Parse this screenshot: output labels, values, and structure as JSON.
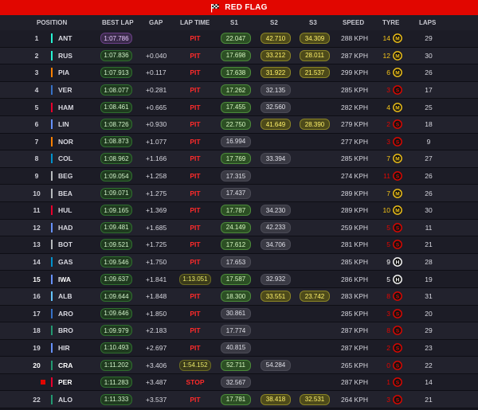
{
  "banner": {
    "label": "RED FLAG",
    "icon": "checkered-flag-icon"
  },
  "columns": {
    "position": "POSITION",
    "best_lap": "BEST LAP",
    "gap": "GAP",
    "lap_time": "LAP TIME",
    "s1": "S1",
    "s2": "S2",
    "s3": "S3",
    "speed": "SPEED",
    "tyre": "TYRE",
    "laps": "LAPS"
  },
  "colors": {
    "red_flag": "#e10600",
    "background": "#15151e",
    "personal_best": "#2c4f24",
    "overall_best": "#6a3f86",
    "sector_yellow": "#8a8426",
    "tyre_soft": "#e10600",
    "tyre_medium": "#f5c518",
    "tyre_hard": "#ffffff"
  },
  "rows": [
    {
      "pos": "1",
      "driver": "ANT",
      "team_color": "#27f4d2",
      "best": "1:07.786",
      "best_style": "purple",
      "gap": "",
      "laptime": "PIT",
      "s1": "22.047",
      "s1c": "green",
      "s2": "42.710",
      "s2c": "yellow",
      "s3": "34.309",
      "s3c": "yellow",
      "speed": "288 KPH",
      "tyre_laps": "14",
      "tyre": "M",
      "laps": "29"
    },
    {
      "pos": "2",
      "driver": "RUS",
      "team_color": "#27f4d2",
      "best": "1:07.836",
      "best_style": "green",
      "gap": "+0.040",
      "laptime": "PIT",
      "s1": "17.698",
      "s1c": "green",
      "s2": "33.212",
      "s2c": "yellow",
      "s3": "28.011",
      "s3c": "yellow",
      "speed": "287 KPH",
      "tyre_laps": "12",
      "tyre": "M",
      "laps": "30"
    },
    {
      "pos": "3",
      "driver": "PIA",
      "team_color": "#ff8000",
      "best": "1:07.913",
      "best_style": "green",
      "gap": "+0.117",
      "laptime": "PIT",
      "s1": "17.638",
      "s1c": "green",
      "s2": "31.922",
      "s2c": "yellow",
      "s3": "21.537",
      "s3c": "yellow",
      "speed": "299 KPH",
      "tyre_laps": "6",
      "tyre": "M",
      "laps": "26"
    },
    {
      "pos": "4",
      "driver": "VER",
      "team_color": "#3671c6",
      "best": "1:08.077",
      "best_style": "green",
      "gap": "+0.281",
      "laptime": "PIT",
      "s1": "17.262",
      "s1c": "green",
      "s2": "32.135",
      "s2c": "grey",
      "s3": "",
      "s3c": "",
      "speed": "285 KPH",
      "tyre_laps": "3",
      "tyre": "S",
      "laps": "17"
    },
    {
      "pos": "5",
      "driver": "HAM",
      "team_color": "#e8002d",
      "best": "1:08.461",
      "best_style": "green",
      "gap": "+0.665",
      "laptime": "PIT",
      "s1": "17.455",
      "s1c": "green",
      "s2": "32.560",
      "s2c": "grey",
      "s3": "",
      "s3c": "",
      "speed": "282 KPH",
      "tyre_laps": "4",
      "tyre": "M",
      "laps": "25"
    },
    {
      "pos": "6",
      "driver": "LIN",
      "team_color": "#6692ff",
      "best": "1:08.726",
      "best_style": "green",
      "gap": "+0.930",
      "laptime": "PIT",
      "s1": "22.750",
      "s1c": "green",
      "s2": "41.649",
      "s2c": "yellow",
      "s3": "28.390",
      "s3c": "yellow",
      "speed": "279 KPH",
      "tyre_laps": "2",
      "tyre": "S",
      "laps": "18"
    },
    {
      "pos": "7",
      "driver": "NOR",
      "team_color": "#ff8000",
      "best": "1:08.873",
      "best_style": "green",
      "gap": "+1.077",
      "laptime": "PIT",
      "s1": "16.994",
      "s1c": "grey",
      "s2": "",
      "s2c": "",
      "s3": "",
      "s3c": "",
      "speed": "277 KPH",
      "tyre_laps": "3",
      "tyre": "S",
      "laps": "9"
    },
    {
      "pos": "8",
      "driver": "COL",
      "team_color": "#0093cc",
      "best": "1:08.962",
      "best_style": "green",
      "gap": "+1.166",
      "laptime": "PIT",
      "s1": "17.769",
      "s1c": "green",
      "s2": "33.394",
      "s2c": "grey",
      "s3": "",
      "s3c": "",
      "speed": "285 KPH",
      "tyre_laps": "7",
      "tyre": "M",
      "laps": "27"
    },
    {
      "pos": "9",
      "driver": "BEG",
      "team_color": "#b6babd",
      "best": "1:09.054",
      "best_style": "green",
      "gap": "+1.258",
      "laptime": "PIT",
      "s1": "17.315",
      "s1c": "grey",
      "s2": "",
      "s2c": "",
      "s3": "",
      "s3c": "",
      "speed": "274 KPH",
      "tyre_laps": "11",
      "tyre": "S",
      "laps": "26"
    },
    {
      "pos": "10",
      "driver": "BEA",
      "team_color": "#b6babd",
      "best": "1:09.071",
      "best_style": "green",
      "gap": "+1.275",
      "laptime": "PIT",
      "s1": "17.437",
      "s1c": "grey",
      "s2": "",
      "s2c": "",
      "s3": "",
      "s3c": "",
      "speed": "289 KPH",
      "tyre_laps": "7",
      "tyre": "M",
      "laps": "26"
    },
    {
      "pos": "11",
      "driver": "HUL",
      "team_color": "#e8002d",
      "best": "1:09.165",
      "best_style": "green",
      "gap": "+1.369",
      "laptime": "PIT",
      "s1": "17.787",
      "s1c": "green",
      "s2": "34.230",
      "s2c": "grey",
      "s3": "",
      "s3c": "",
      "speed": "289 KPH",
      "tyre_laps": "10",
      "tyre": "M",
      "laps": "30"
    },
    {
      "pos": "12",
      "driver": "HAD",
      "team_color": "#6692ff",
      "best": "1:09.481",
      "best_style": "green",
      "gap": "+1.685",
      "laptime": "PIT",
      "s1": "24.149",
      "s1c": "green",
      "s2": "42.233",
      "s2c": "grey",
      "s3": "",
      "s3c": "",
      "speed": "259 KPH",
      "tyre_laps": "5",
      "tyre": "S",
      "laps": "11"
    },
    {
      "pos": "13",
      "driver": "BOT",
      "team_color": "#b6babd",
      "best": "1:09.521",
      "best_style": "green",
      "gap": "+1.725",
      "laptime": "PIT",
      "s1": "17.612",
      "s1c": "green",
      "s2": "34.706",
      "s2c": "grey",
      "s3": "",
      "s3c": "",
      "speed": "281 KPH",
      "tyre_laps": "5",
      "tyre": "S",
      "laps": "21"
    },
    {
      "pos": "14",
      "driver": "GAS",
      "team_color": "#0093cc",
      "best": "1:09.546",
      "best_style": "green",
      "gap": "+1.750",
      "laptime": "PIT",
      "s1": "17.653",
      "s1c": "grey",
      "s2": "",
      "s2c": "",
      "s3": "",
      "s3c": "",
      "speed": "285 KPH",
      "tyre_laps": "9",
      "tyre": "H",
      "laps": "28"
    },
    {
      "pos": "15",
      "driver": "IWA",
      "team_color": "#6692ff",
      "best": "1:09.637",
      "best_style": "green",
      "gap": "+1.841",
      "laptime": "1:13.051",
      "s1": "17.587",
      "s1c": "green",
      "s2": "32.932",
      "s2c": "grey",
      "s3": "",
      "s3c": "",
      "speed": "286 KPH",
      "tyre_laps": "5",
      "tyre": "H",
      "laps": "19",
      "highlight": true
    },
    {
      "pos": "16",
      "driver": "ALB",
      "team_color": "#64c4ff",
      "best": "1:09.644",
      "best_style": "green",
      "gap": "+1.848",
      "laptime": "PIT",
      "s1": "18.300",
      "s1c": "green",
      "s2": "33.551",
      "s2c": "yellow",
      "s3": "23.742",
      "s3c": "yellow",
      "speed": "283 KPH",
      "tyre_laps": "8",
      "tyre": "S",
      "laps": "31"
    },
    {
      "pos": "17",
      "driver": "ARO",
      "team_color": "#3671c6",
      "best": "1:09.646",
      "best_style": "green",
      "gap": "+1.850",
      "laptime": "PIT",
      "s1": "30.861",
      "s1c": "grey",
      "s2": "",
      "s2c": "",
      "s3": "",
      "s3c": "",
      "speed": "285 KPH",
      "tyre_laps": "3",
      "tyre": "S",
      "laps": "20"
    },
    {
      "pos": "18",
      "driver": "BRO",
      "team_color": "#229971",
      "best": "1:09.979",
      "best_style": "green",
      "gap": "+2.183",
      "laptime": "PIT",
      "s1": "17.774",
      "s1c": "grey",
      "s2": "",
      "s2c": "",
      "s3": "",
      "s3c": "",
      "speed": "287 KPH",
      "tyre_laps": "8",
      "tyre": "S",
      "laps": "29"
    },
    {
      "pos": "19",
      "driver": "HIR",
      "team_color": "#6692ff",
      "best": "1:10.493",
      "best_style": "green",
      "gap": "+2.697",
      "laptime": "PIT",
      "s1": "40.815",
      "s1c": "grey",
      "s2": "",
      "s2c": "",
      "s3": "",
      "s3c": "",
      "speed": "287 KPH",
      "tyre_laps": "2",
      "tyre": "S",
      "laps": "23"
    },
    {
      "pos": "20",
      "driver": "CRA",
      "team_color": "#229971",
      "best": "1:11.202",
      "best_style": "green",
      "gap": "+3.406",
      "laptime": "1:54.152",
      "s1": "52.711",
      "s1c": "green",
      "s2": "54.284",
      "s2c": "grey",
      "s3": "",
      "s3c": "",
      "speed": "265 KPH",
      "tyre_laps": "0",
      "tyre": "S",
      "laps": "22",
      "highlight": true
    },
    {
      "pos": "",
      "driver": "PER",
      "team_color": "#e8002d",
      "best": "1:11.283",
      "best_style": "green",
      "gap": "+3.487",
      "laptime": "STOP",
      "s1": "32.567",
      "s1c": "grey",
      "s2": "",
      "s2c": "",
      "s3": "",
      "s3c": "",
      "speed": "287 KPH",
      "tyre_laps": "1",
      "tyre": "S",
      "laps": "14",
      "stopped": true
    },
    {
      "pos": "22",
      "driver": "ALO",
      "team_color": "#229971",
      "best": "1:11.333",
      "best_style": "green",
      "gap": "+3.537",
      "laptime": "PIT",
      "s1": "17.781",
      "s1c": "green",
      "s2": "38.418",
      "s2c": "yellow",
      "s3": "32.531",
      "s3c": "yellow",
      "speed": "264 KPH",
      "tyre_laps": "3",
      "tyre": "S",
      "laps": "21"
    }
  ]
}
